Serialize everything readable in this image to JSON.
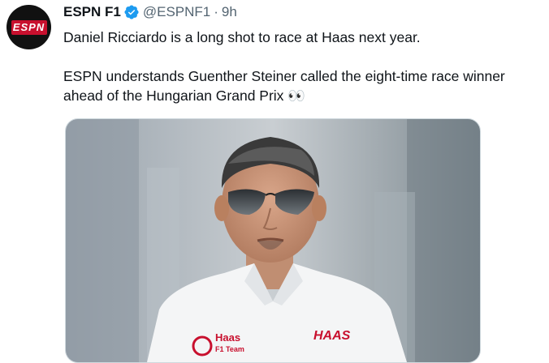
{
  "tweet": {
    "display_name": "ESPN F1",
    "handle": "@ESPNF1",
    "separator": "·",
    "time": "9h",
    "paragraphs": [
      "Daniel Ricciardo is a long shot to race at Haas next year.",
      "ESPN understands Guenther Steiner called the eight-time race winner ahead of the Hungarian Grand Prix 👀"
    ],
    "avatar_logo_text": "ESPN",
    "verified_icon": "verified-badge-icon",
    "media": {
      "shirt_logo_left_line1": "Haas",
      "shirt_logo_left_line2": "F1 Team",
      "shirt_logo_right": "HAAS"
    }
  },
  "colors": {
    "text_primary": "#0f1419",
    "text_secondary": "#536471",
    "verified": "#1d9bf0",
    "haas_red": "#c8102e"
  }
}
